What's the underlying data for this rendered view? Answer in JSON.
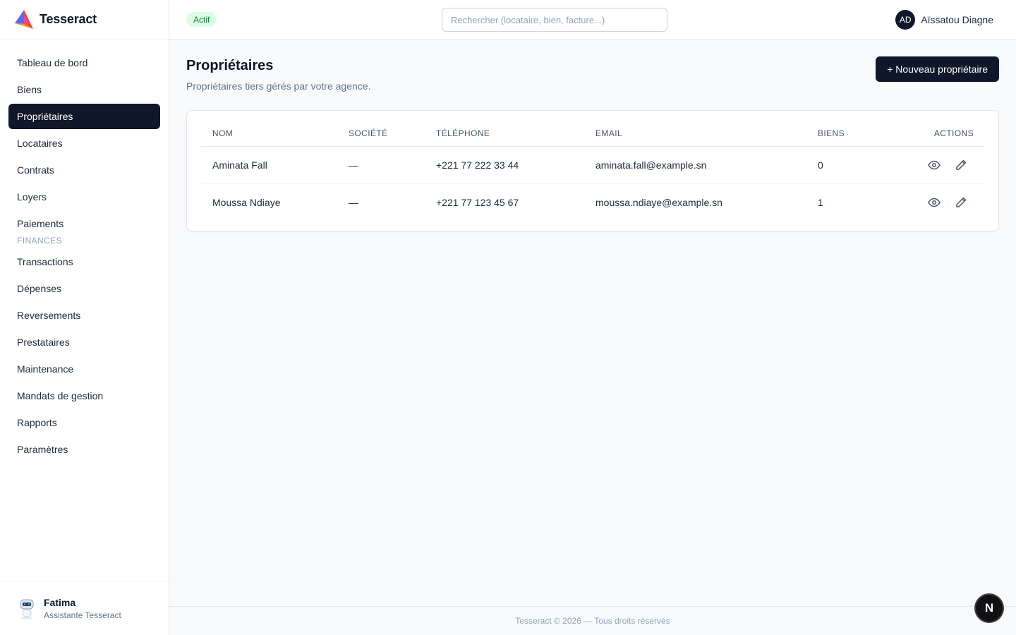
{
  "brand": {
    "name": "Tesseract"
  },
  "sidebar": {
    "items": [
      {
        "label": "Tableau de bord"
      },
      {
        "label": "Biens"
      },
      {
        "label": "Propriétaires",
        "active": true
      },
      {
        "label": "Locataires"
      },
      {
        "label": "Contrats"
      },
      {
        "label": "Loyers"
      },
      {
        "label": "Paiements"
      }
    ],
    "section_label": "FINANCES",
    "finance_items": [
      {
        "label": "Transactions"
      },
      {
        "label": "Dépenses"
      },
      {
        "label": "Reversements"
      },
      {
        "label": "Prestataires"
      },
      {
        "label": "Maintenance"
      },
      {
        "label": "Mandats de gestion"
      },
      {
        "label": "Rapports"
      },
      {
        "label": "Paramètres"
      }
    ],
    "assistant": {
      "name": "Fatima",
      "role": "Assistante Tesseract"
    }
  },
  "header": {
    "status_badge": "Actif",
    "search_placeholder": "Rechercher (locataire, bien, facture...)",
    "user": {
      "initials": "AD",
      "name": "Aïssatou Diagne"
    }
  },
  "main": {
    "title": "Propriétaires",
    "subtitle": "Propriétaires tiers gérés par votre agence.",
    "new_button": "+ Nouveau propriétaire",
    "table": {
      "columns": [
        "NOM",
        "SOCIÉTÉ",
        "TÉLÉPHONE",
        "EMAIL",
        "BIENS",
        "ACTIONS"
      ],
      "rows": [
        {
          "nom": "Aminata Fall",
          "societe": "—",
          "telephone": "+221 77 222 33 44",
          "email": "aminata.fall@example.sn",
          "biens": "0"
        },
        {
          "nom": "Moussa Ndiaye",
          "societe": "—",
          "telephone": "+221 77 123 45 67",
          "email": "moussa.ndiaye@example.sn",
          "biens": "1"
        }
      ]
    }
  },
  "footer": {
    "text": "Tesseract © 2026 — Tous droits réservés"
  },
  "fab": {
    "label": "N"
  },
  "colors": {
    "primary": "#0f172a",
    "badge_bg": "#dcfce7",
    "badge_text": "#15803d",
    "muted": "#64748b"
  }
}
